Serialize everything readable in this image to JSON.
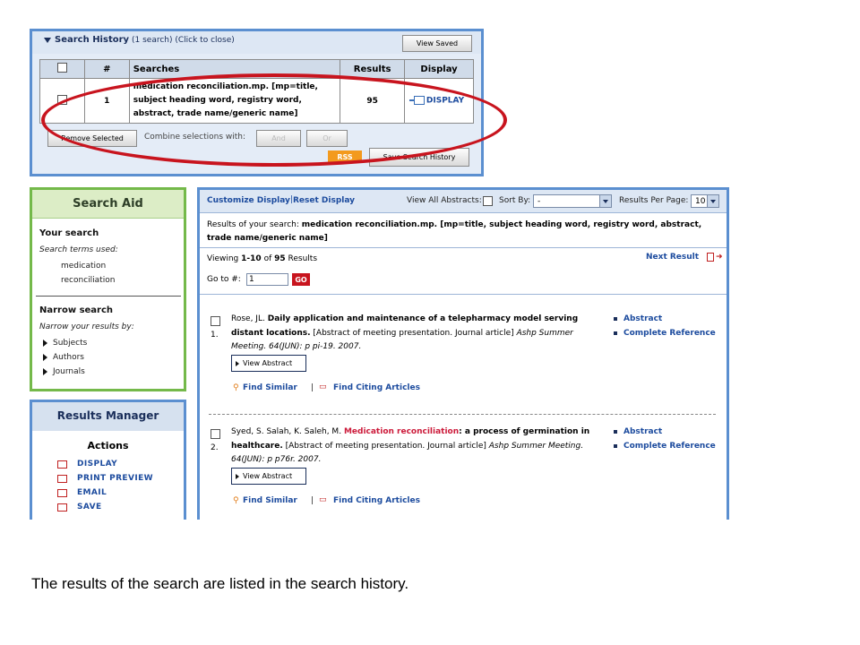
{
  "search_history": {
    "title": "Search History",
    "subtitle": "(1 search) (Click to close)",
    "view_saved": "View Saved",
    "columns": [
      "#",
      "Searches",
      "Results",
      "Display"
    ],
    "rows": [
      {
        "num": "1",
        "search": "medication reconciliation.mp. [mp=title, subject heading word, registry word, abstract, trade name/generic name]",
        "results": "95",
        "display": "DISPLAY"
      }
    ],
    "remove_selected": "Remove Selected",
    "combine_label": "Combine selections with:",
    "and_label": "And",
    "or_label": "Or",
    "rss_label": "RSS",
    "save_history": "Save Search History"
  },
  "search_aid": {
    "title": "Search Aid",
    "your_search": "Your search",
    "terms_used": "Search terms used:",
    "terms": [
      "medication",
      "reconciliation"
    ],
    "narrow_search": "Narrow search",
    "narrow_by": "Narrow your results by:",
    "facets": [
      "Subjects",
      "Authors",
      "Journals"
    ]
  },
  "results_manager": {
    "title": "Results Manager",
    "actions_label": "Actions",
    "actions": [
      "DISPLAY",
      "PRINT PREVIEW",
      "EMAIL",
      "SAVE"
    ]
  },
  "toolbar": {
    "customize_display": "Customize Display",
    "reset_display": "Reset Display",
    "view_all_abstracts": "View All Abstracts:",
    "sort_by": "Sort By:",
    "sort_value": "-",
    "results_per_page": "Results Per Page:",
    "per_page_value": "10"
  },
  "results": {
    "summary_prefix": "Results of your search:",
    "summary_query": "medication reconciliation.mp. [mp=title, subject heading word, registry word, abstract, trade name/generic name]",
    "viewing_prefix": "Viewing",
    "viewing_range": "1-10",
    "viewing_of": "of",
    "viewing_total": "95",
    "viewing_suffix": "Results",
    "next_result": "Next Result",
    "goto_label": "Go to #:",
    "goto_value": "1",
    "go_label": "GO",
    "abstract_label": "Abstract",
    "complete_ref_label": "Complete Reference",
    "view_abstract_label": "View Abstract",
    "find_similar_label": "Find Similar",
    "find_citing_label": "Find Citing Articles",
    "items": [
      {
        "num": "1.",
        "authors": "Rose, JL.",
        "title_plain": "Daily application and maintenance of a telepharmacy model serving distant locations.",
        "title_highlight": "",
        "title_rest": "",
        "details": "[Abstract of meeting presentation. Journal article]",
        "source": "Ashp Summer Meeting. 64(JUN): p pi-19. 2007."
      },
      {
        "num": "2.",
        "authors": "Syed, S. Salah, K. Saleh, M.",
        "title_plain": "",
        "title_highlight": "Medication reconciliation",
        "title_rest": ": a process of germination in healthcare.",
        "details": "[Abstract of meeting presentation. Journal article]",
        "source": "Ashp Summer Meeting. 64(JUN): p p76r. 2007."
      }
    ]
  },
  "caption": "The results of the search are listed in the search history.",
  "colors": {
    "panel_blue": "#5b8fd0",
    "aid_green": "#74b94a",
    "link_blue": "#1c4b9e",
    "highlight_oval": "#c8141e",
    "rss_orange": "#f39a1e"
  }
}
